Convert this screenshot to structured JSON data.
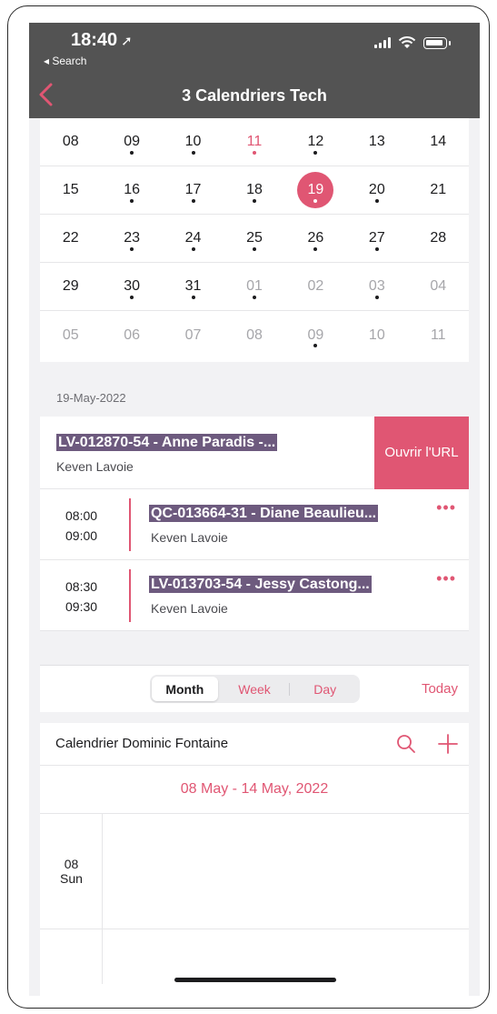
{
  "status_bar": {
    "time": "18:40",
    "back_label": "◂ Search"
  },
  "nav": {
    "title": "3 Calendriers Tech"
  },
  "month": {
    "weeks": [
      [
        {
          "n": "08",
          "dot": false
        },
        {
          "n": "09",
          "dot": true
        },
        {
          "n": "10",
          "dot": true
        },
        {
          "n": "11",
          "dot": true,
          "red": true
        },
        {
          "n": "12",
          "dot": true
        },
        {
          "n": "13",
          "dot": false
        },
        {
          "n": "14",
          "dot": false
        }
      ],
      [
        {
          "n": "15",
          "dot": false
        },
        {
          "n": "16",
          "dot": true
        },
        {
          "n": "17",
          "dot": true
        },
        {
          "n": "18",
          "dot": true
        },
        {
          "n": "19",
          "dot": true,
          "selected": true
        },
        {
          "n": "20",
          "dot": true
        },
        {
          "n": "21",
          "dot": false
        }
      ],
      [
        {
          "n": "22",
          "dot": false
        },
        {
          "n": "23",
          "dot": true
        },
        {
          "n": "24",
          "dot": true
        },
        {
          "n": "25",
          "dot": true
        },
        {
          "n": "26",
          "dot": true
        },
        {
          "n": "27",
          "dot": true
        },
        {
          "n": "28",
          "dot": false
        }
      ],
      [
        {
          "n": "29",
          "dot": false
        },
        {
          "n": "30",
          "dot": true
        },
        {
          "n": "31",
          "dot": true
        },
        {
          "n": "01",
          "dot": true,
          "muted": true
        },
        {
          "n": "02",
          "dot": false,
          "muted": true
        },
        {
          "n": "03",
          "dot": true,
          "muted": true
        },
        {
          "n": "04",
          "dot": false,
          "muted": true
        }
      ],
      [
        {
          "n": "05",
          "dot": false,
          "muted": true
        },
        {
          "n": "06",
          "dot": false,
          "muted": true
        },
        {
          "n": "07",
          "dot": false,
          "muted": true
        },
        {
          "n": "08",
          "dot": false,
          "muted": true
        },
        {
          "n": "09",
          "dot": true,
          "muted": true
        },
        {
          "n": "10",
          "dot": false,
          "muted": true
        },
        {
          "n": "11",
          "dot": false,
          "muted": true
        }
      ]
    ]
  },
  "selected_date": "19-May-2022",
  "first_event": {
    "title": "LV-012870-54 - Anne Paradis -...",
    "person": "Keven Lavoie",
    "open_url_label": "Ouvrir l'URL"
  },
  "events": [
    {
      "start": "08:00",
      "end": "09:00",
      "title": "QC-013664-31 - Diane Beaulieu...",
      "person": "Keven Lavoie",
      "more": "•••"
    },
    {
      "start": "08:30",
      "end": "09:30",
      "title": "LV-013703-54 - Jessy Castong...",
      "person": "Keven Lavoie",
      "more": "•••"
    }
  ],
  "view_switch": {
    "month": "Month",
    "week": "Week",
    "day": "Day",
    "today": "Today"
  },
  "week_view": {
    "calendar_name": "Calendrier Dominic Fontaine",
    "range": "08 May - 14 May, 2022",
    "day_number": "08",
    "day_name": "Sun"
  },
  "colors": {
    "accent": "#e05673",
    "highlight": "#6d5a7e",
    "navbar": "#535353"
  }
}
